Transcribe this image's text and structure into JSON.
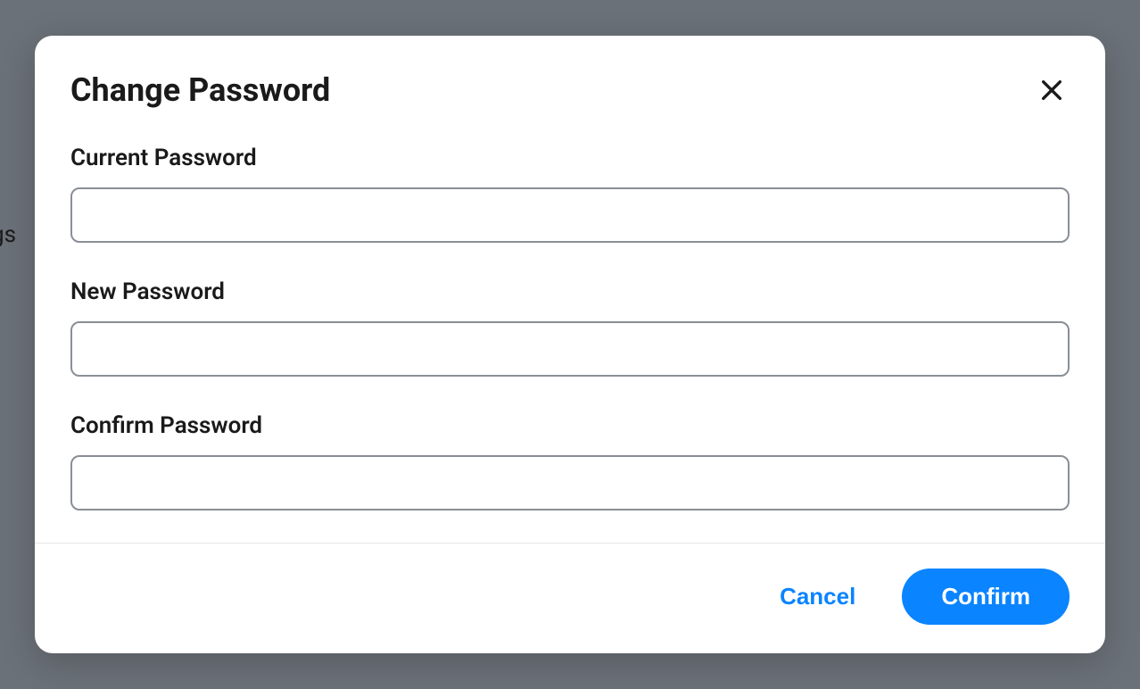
{
  "background": {
    "partial_text": "gs"
  },
  "modal": {
    "title": "Change Password",
    "fields": {
      "current": {
        "label": "Current Password",
        "value": ""
      },
      "new": {
        "label": "New Password",
        "value": ""
      },
      "confirm": {
        "label": "Confirm Password",
        "value": ""
      }
    },
    "actions": {
      "cancel": "Cancel",
      "confirm": "Confirm"
    }
  }
}
